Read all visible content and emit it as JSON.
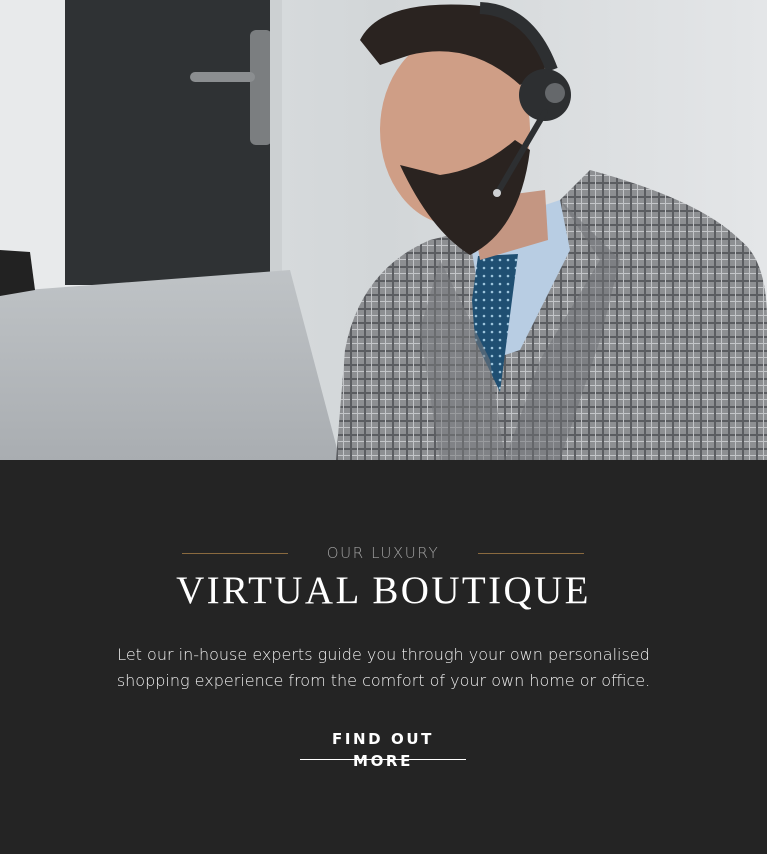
{
  "hero": {
    "image_alt": "Virtual boutique consultant wearing a headset"
  },
  "panel": {
    "eyebrow": "OUR LUXURY",
    "title": "VIRTUAL BOUTIQUE",
    "description": "Let our in-house experts guide you through your own personalised shopping experience from the comfort of your own home or office.",
    "cta_label": "FIND OUT MORE"
  },
  "colors": {
    "panel_background": "#242424",
    "accent_rule": "#8a6a3f",
    "text": "#ffffff"
  }
}
